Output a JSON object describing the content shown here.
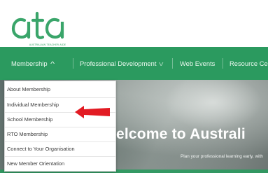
{
  "header": {
    "logo_text": "ata",
    "logo_tagline": "AUSTRALIAN TEACHER AIDE"
  },
  "nav": {
    "items": [
      {
        "label": "Membership",
        "state": "open"
      },
      {
        "label": "Professional Development",
        "state": "closed"
      },
      {
        "label": "Web Events"
      },
      {
        "label": "Resource Ce"
      }
    ]
  },
  "dropdown": {
    "items": [
      {
        "label": "About Membership"
      },
      {
        "label": "Individual Membership"
      },
      {
        "label": "School Membership",
        "highlighted_by_arrow": true
      },
      {
        "label": "RTO Membership"
      },
      {
        "label": "Connect to Your Organisation"
      },
      {
        "label": "New Member Orientation"
      }
    ]
  },
  "hero": {
    "title": "elcome to Australi",
    "subtitle": "Plan your professional learning early, with"
  },
  "colors": {
    "brand_green": "#2b9a5f",
    "logo_green": "#3aa56a",
    "arrow_red": "#e21b23"
  },
  "icons": {
    "membership_chevron": "chevron-up-icon",
    "professional_dev_chevron": "chevron-down-icon",
    "annotation_arrow": "red-arrow-icon"
  }
}
